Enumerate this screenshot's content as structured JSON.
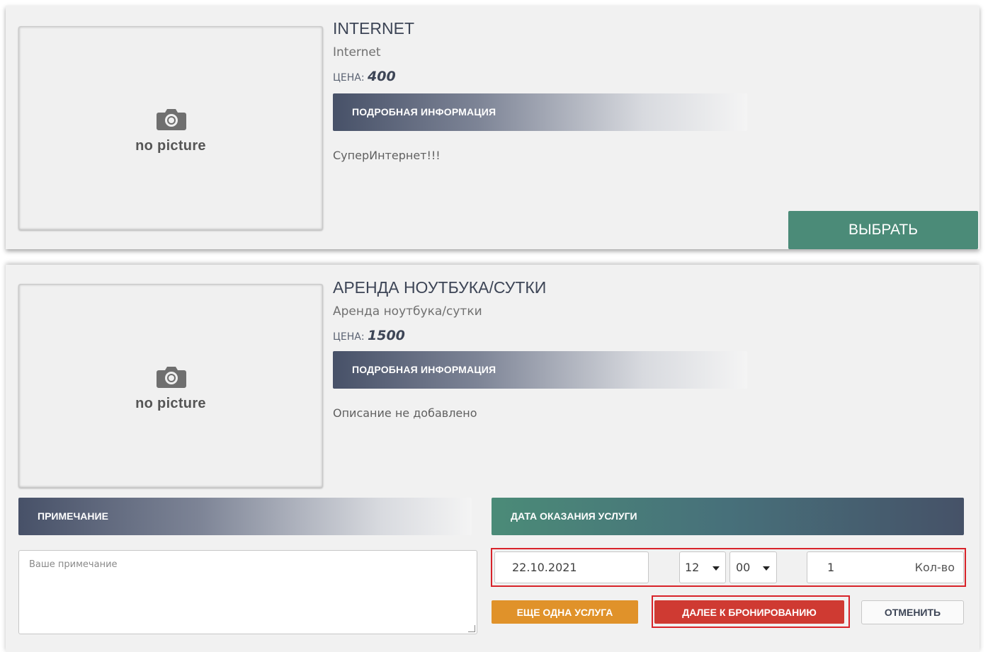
{
  "services": [
    {
      "image_placeholder": "no picture",
      "title": "INTERNET",
      "subtitle": "Internet",
      "price_label": "ЦЕНА:",
      "price_value": "400",
      "details_label": "ПОДРОБНАЯ ИНФОРМАЦИЯ",
      "description": "СуперИнтернет!!!",
      "select_label": "ВЫБРАТЬ"
    },
    {
      "image_placeholder": "no picture",
      "title": "АРЕНДА НОУТБУКА/СУТКИ",
      "subtitle": "Аренда ноутбука/сутки",
      "price_label": "ЦЕНА:",
      "price_value": "1500",
      "details_label": "ПОДРОБНАЯ ИНФОРМАЦИЯ",
      "description": "Описание не добавлено"
    }
  ],
  "booking": {
    "note_header": "ПРИМЕЧАНИЕ",
    "date_header": "ДАТА ОКАЗАНИЯ УСЛУГИ",
    "note_placeholder": "Ваше примечание",
    "date_value": "22.10.2021",
    "hour_value": "12",
    "minute_value": "00",
    "quantity_value": "1",
    "quantity_label": "Кол-во",
    "add_service_label": "ЕЩЕ ОДНА УСЛУГА",
    "proceed_label": "ДАЛЕЕ К БРОНИРОВАНИЮ",
    "cancel_label": "ОТМЕНИТЬ"
  },
  "colors": {
    "accent_green": "#4b8b78",
    "slate": "#475168",
    "orange": "#e0922a",
    "red": "#cf3a32",
    "highlight_red": "#d8232a"
  },
  "icons": [
    "camera-icon",
    "chevron-down-icon",
    "resize-grip-icon"
  ]
}
